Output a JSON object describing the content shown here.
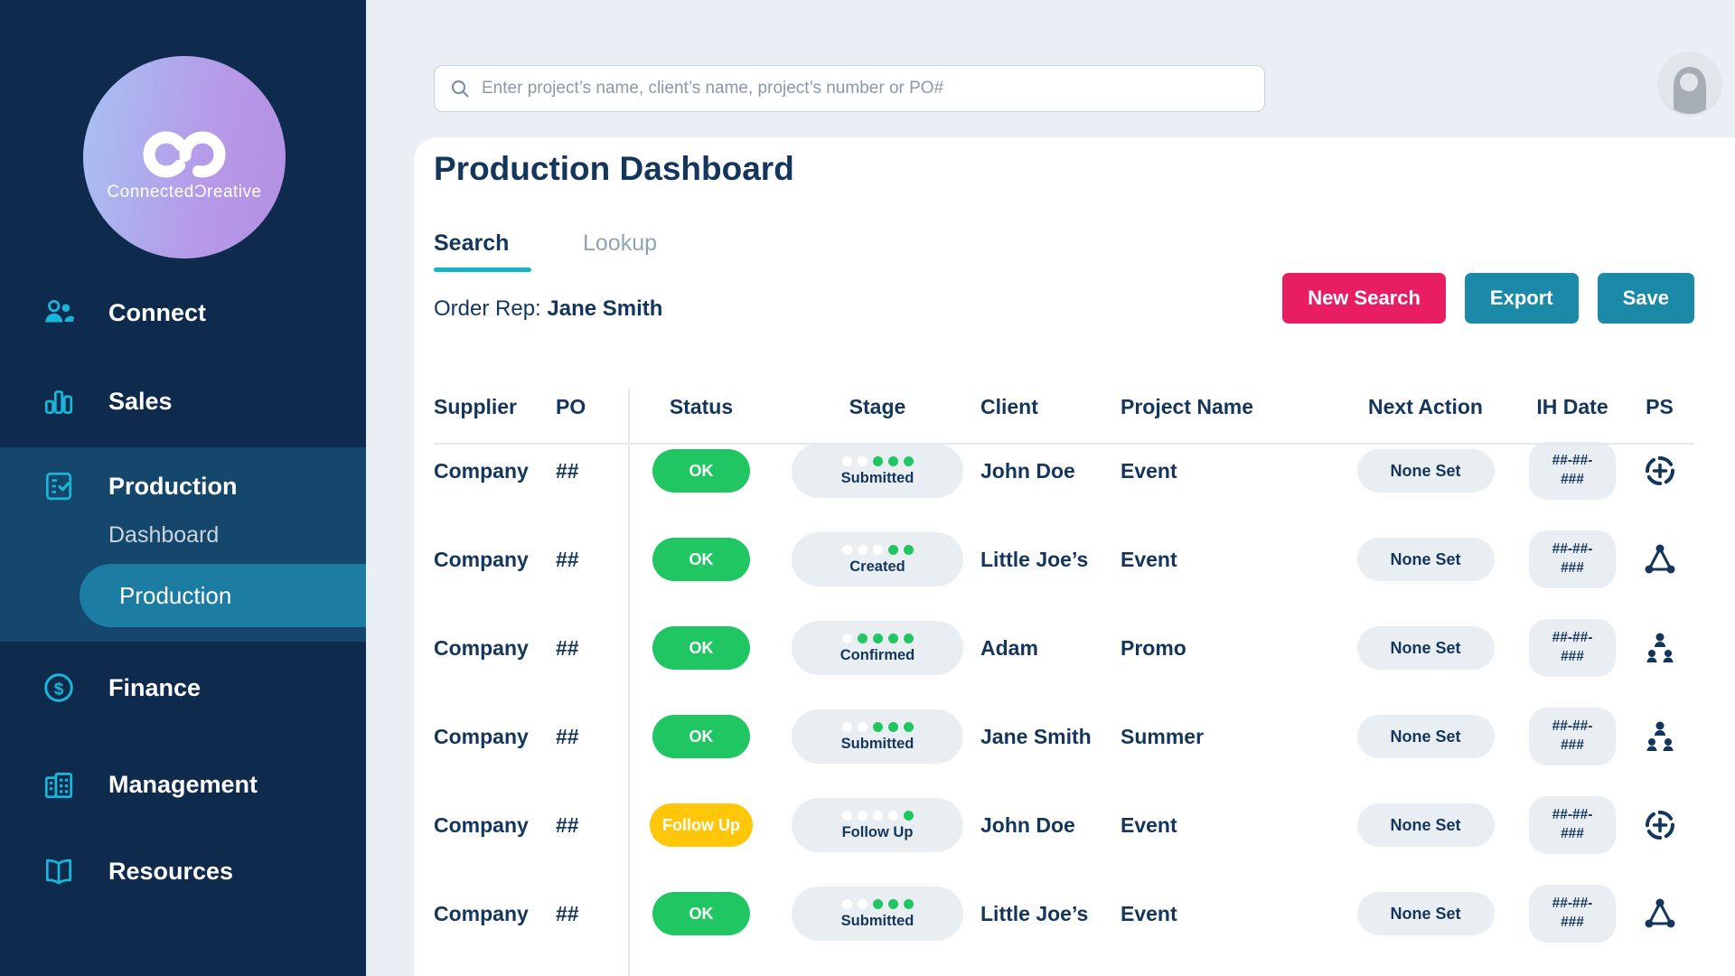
{
  "brand": {
    "name": "ConnectedƆreative"
  },
  "sidebar": {
    "items": [
      {
        "label": "Connect"
      },
      {
        "label": "Sales"
      },
      {
        "label": "Production",
        "children": [
          {
            "label": "Dashboard"
          },
          {
            "label": "Production"
          }
        ]
      },
      {
        "label": "Finance"
      },
      {
        "label": "Management"
      },
      {
        "label": "Resources"
      }
    ]
  },
  "topbar": {
    "search_placeholder": "Enter project’s name, client’s name, project’s number or PO#"
  },
  "main": {
    "title": "Production Dashboard",
    "tabs": [
      {
        "label": "Search"
      },
      {
        "label": "Lookup"
      }
    ],
    "order_rep_label": "Order Rep:",
    "order_rep_name": "Jane Smith",
    "actions": {
      "new_search": "New Search",
      "export": "Export",
      "save": "Save"
    }
  },
  "table": {
    "columns": [
      "Supplier",
      "PO",
      "Status",
      "Stage",
      "Client",
      "Project Name",
      "Next Action",
      "IH Date",
      "PS"
    ],
    "rows": [
      {
        "supplier": "Company",
        "po": "##",
        "status": "OK",
        "status_color": "green",
        "stage": "Submitted",
        "progress": [
          0,
          0,
          1,
          1,
          1
        ],
        "client": "John Doe",
        "project": "Event",
        "next_action": "None Set",
        "ih_date_line1": "##-##-",
        "ih_date_line2": "###",
        "ps_icon": "target-add"
      },
      {
        "supplier": "Company",
        "po": "##",
        "status": "OK",
        "status_color": "green",
        "stage": "Created",
        "progress": [
          0,
          0,
          0,
          1,
          1
        ],
        "client": "Little Joe’s",
        "project": "Event",
        "next_action": "None Set",
        "ih_date_line1": "##-##-",
        "ih_date_line2": "###",
        "ps_icon": "tri-network"
      },
      {
        "supplier": "Company",
        "po": "##",
        "status": "OK",
        "status_color": "green",
        "stage": "Confirmed",
        "progress": [
          0,
          1,
          1,
          1,
          1
        ],
        "client": "Adam",
        "project": "Promo",
        "next_action": "None Set",
        "ih_date_line1": "##-##-",
        "ih_date_line2": "###",
        "ps_icon": "people-group"
      },
      {
        "supplier": "Company",
        "po": "##",
        "status": "OK",
        "status_color": "green",
        "stage": "Submitted",
        "progress": [
          0,
          0,
          1,
          1,
          1
        ],
        "client": "Jane Smith",
        "project": "Summer",
        "next_action": "None Set",
        "ih_date_line1": "##-##-",
        "ih_date_line2": "###",
        "ps_icon": "people-group"
      },
      {
        "supplier": "Company",
        "po": "##",
        "status": "Follow Up",
        "status_color": "yellow",
        "stage": "Follow Up",
        "progress": [
          0,
          0,
          0,
          0,
          1
        ],
        "client": "John Doe",
        "project": "Event",
        "next_action": "None Set",
        "ih_date_line1": "##-##-",
        "ih_date_line2": "###",
        "ps_icon": "target-add"
      },
      {
        "supplier": "Company",
        "po": "##",
        "status": "OK",
        "status_color": "green",
        "stage": "Submitted",
        "progress": [
          0,
          0,
          1,
          1,
          1
        ],
        "client": "Little Joe’s",
        "project": "Event",
        "next_action": "None Set",
        "ih_date_line1": "##-##-",
        "ih_date_line2": "###",
        "ps_icon": "tri-network"
      }
    ]
  },
  "colors": {
    "sidebar_navy": "#0e2a4d",
    "section_navy": "#15466b",
    "active_teal": "#1d7ca1",
    "accent_cyan": "#18b7d9",
    "green": "#1fc662",
    "yellow": "#ffc60a",
    "pink": "#e81d62",
    "teal_button": "#1b89a8",
    "navy_text": "#14365c",
    "pill_bg": "#e9eef3",
    "page_bg": "#e9eff4"
  }
}
